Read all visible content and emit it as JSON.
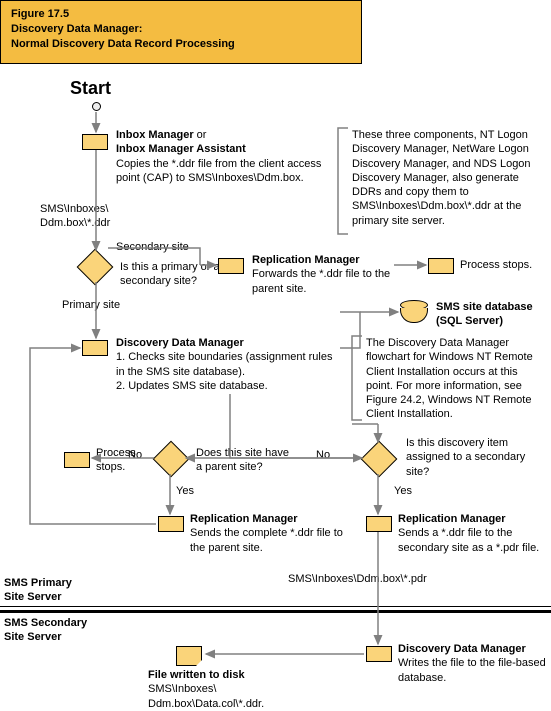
{
  "title": {
    "line1": "Figure 17.5",
    "line2": "Discovery Data Manager:",
    "line3": "Normal Discovery Data Record Processing"
  },
  "start": "Start",
  "nodes": {
    "inbox": {
      "heading": "Inbox Manager",
      "or": " or",
      "heading2": "Inbox Manager Assistant",
      "desc": "Copies the *.ddr file from the client access point (CAP) to SMS\\Inboxes\\Ddm.box."
    },
    "sideNote1": "These three components, NT Logon Discovery Manager, NetWare Logon Discovery Manager, and NDS Logon Discovery Manager, also generate DDRs and copy them to SMS\\Inboxes\\Ddm.box\\*.ddr at the primary site server.",
    "pathLabel1": "SMS\\Inboxes\\ Ddm.box\\*.ddr",
    "decision1": {
      "question": "Is this a primary or a secondary site?",
      "branchSecondary": "Secondary site",
      "branchPrimary": "Primary site"
    },
    "repl1": {
      "heading": "Replication Manager",
      "desc": "Forwards the *.ddr file to the parent site."
    },
    "stop1": "Process stops.",
    "db": "SMS site database (SQL Server)",
    "ddm": {
      "heading": "Discovery Data Manager",
      "line1": "1. Checks site boundaries (assignment rules in the SMS site database).",
      "line2": "2. Updates SMS site database."
    },
    "sideNote2": "The Discovery Data Manager flowchart for Windows NT Remote Client Installation occurs at this point. For more information, see Figure 24.2, Windows NT Remote Client Installation.",
    "decision2": {
      "question": "Is this discovery item assigned to a secondary site?",
      "yes": "Yes",
      "no": "No"
    },
    "decision3": {
      "question": "Does this site have a parent site?",
      "yes": "Yes",
      "no": "No"
    },
    "stop2": "Process stops.",
    "repl2": {
      "heading": "Replication Manager",
      "desc": "Sends the complete *.ddr file to the parent site."
    },
    "repl3": {
      "heading": "Replication Manager",
      "desc": "Sends a *.ddr file to the secondary site as a *.pdr file."
    },
    "pathLabel2": "SMS\\Inboxes\\Ddm.box\\*.pdr",
    "primaryServer": "SMS Primary Site Server",
    "secondaryServer": "SMS Secondary Site Server",
    "ddm2": {
      "heading": "Discovery Data Manager",
      "desc": "Writes the file to the file-based database."
    },
    "fileWritten": {
      "heading": "File written to disk",
      "desc": "SMS\\Inboxes\\ Ddm.box\\Data.col\\*.ddr."
    }
  }
}
